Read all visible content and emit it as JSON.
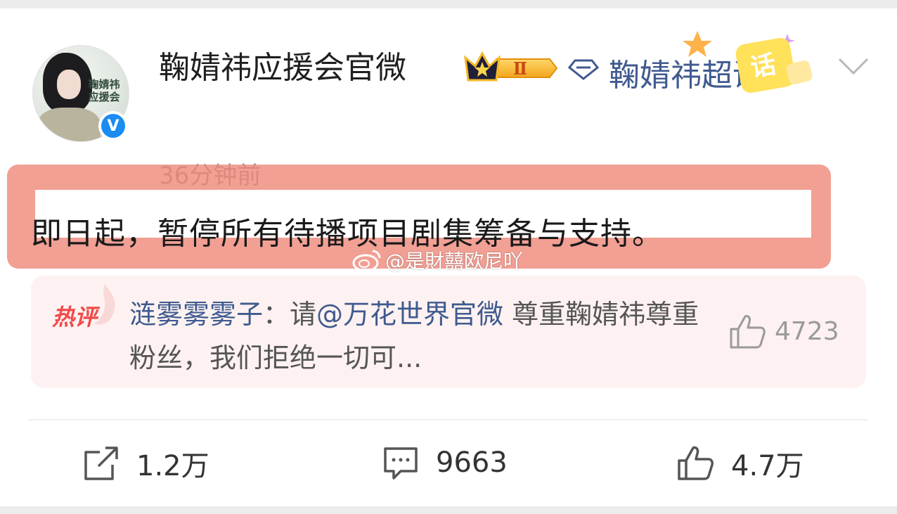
{
  "post": {
    "author": {
      "name": "鞠婧祎应援会官微",
      "avatar_caption": "鞠婧祎应援会",
      "level_badge": "Ⅱ",
      "verified_icon": "V"
    },
    "topic_link": {
      "name": "鞠婧祎超话",
      "badge_text": "话"
    },
    "time": "36分钟前",
    "text": "即日起，暂停所有待播项目剧集筹备与支持。",
    "watermark": "@是財囍欧尼吖"
  },
  "hot_comment": {
    "tag": "热评",
    "author": "涟雾雾雾子",
    "separator": "：",
    "text_before_mention": "请",
    "mention": "@万花世界官微",
    "text_after_mention": " 尊重鞠婧祎尊重粉丝，我们拒绝一切可...",
    "likes": "4723"
  },
  "actions": {
    "share": "1.2万",
    "comments": "9663",
    "likes": "4.7万"
  },
  "colors": {
    "link": "#3f5a8f",
    "highlight": "#ee8476",
    "hot_tag": "#f04a48",
    "verified": "#1a8cf2"
  }
}
